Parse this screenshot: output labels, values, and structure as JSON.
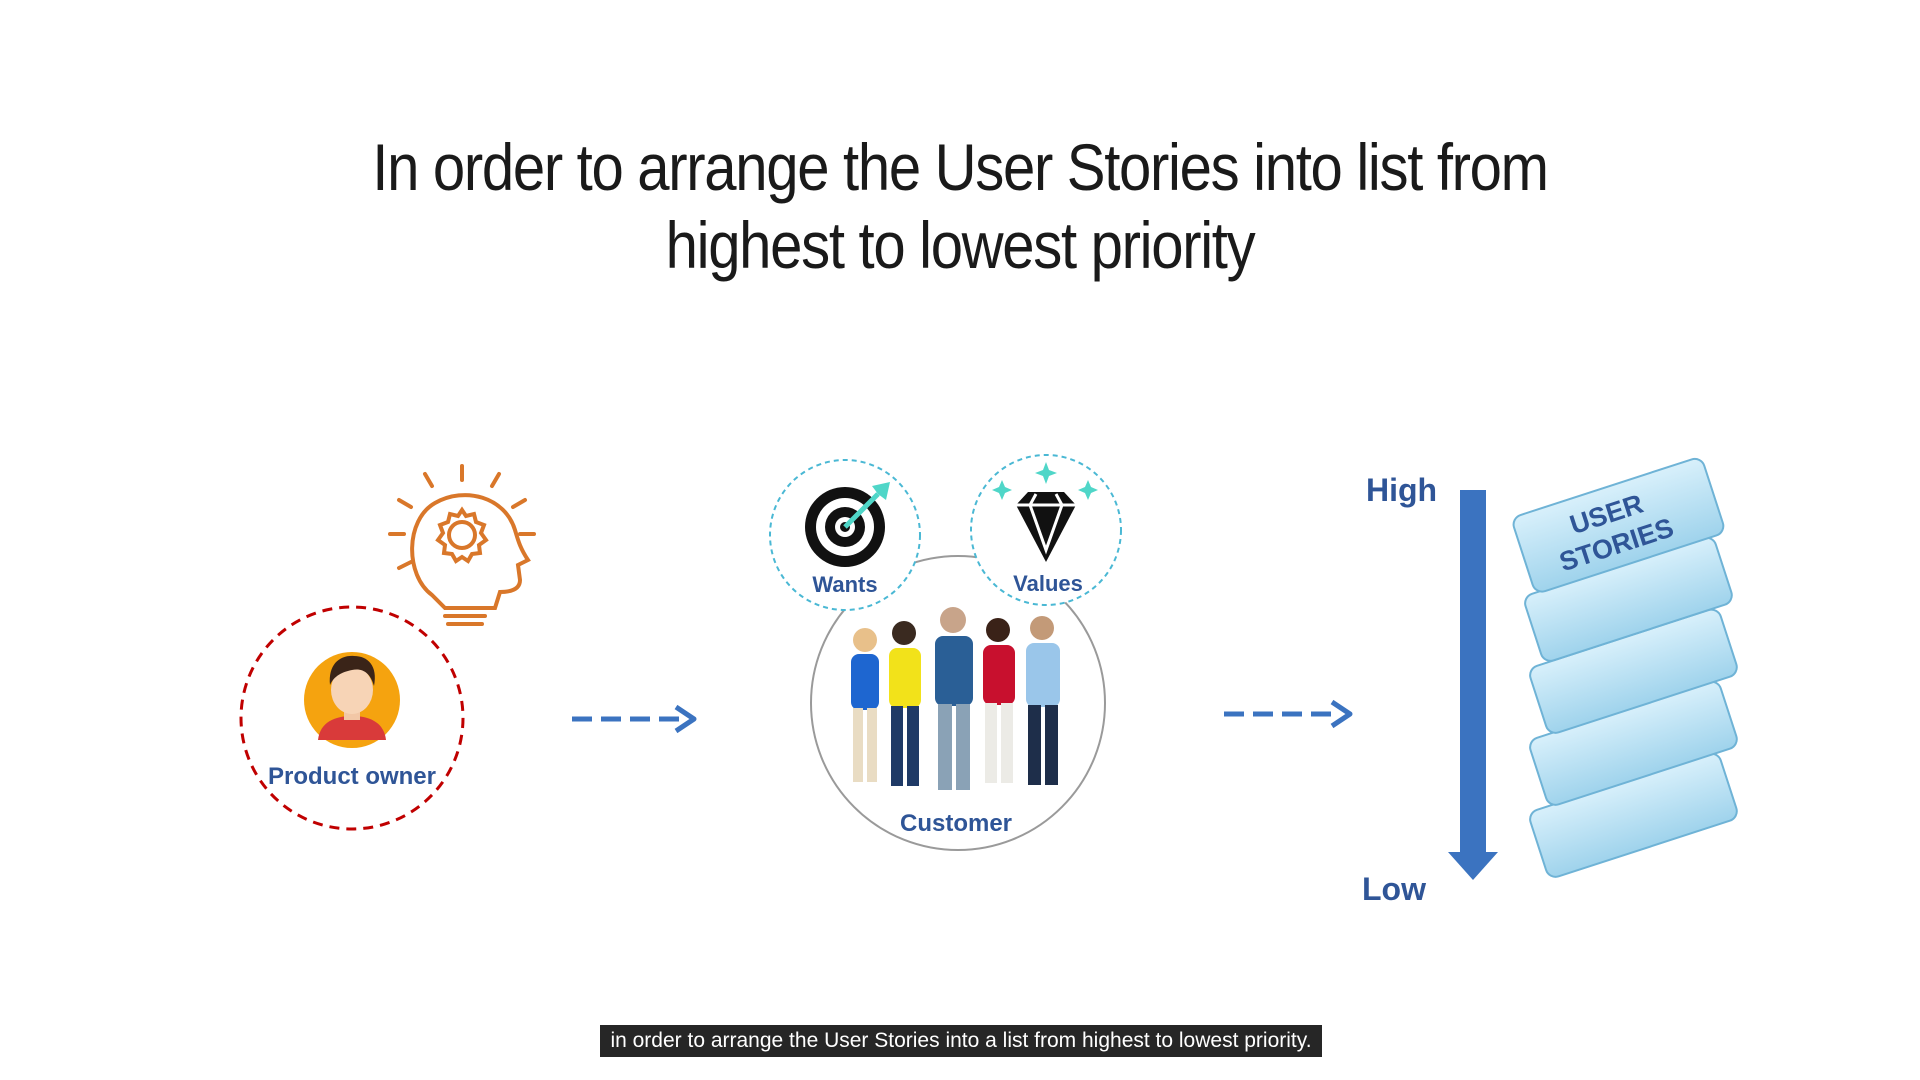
{
  "title": {
    "line1": "In order to arrange the User Stories into list from",
    "line2": "highest to lowest priority"
  },
  "labels": {
    "product_owner": "Product owner",
    "wants": "Wants",
    "values": "Values",
    "customer": "Customer",
    "high": "High",
    "low": "Low",
    "user": "USER",
    "stories": "STORIES"
  },
  "subtitle": "in order to arrange the User Stories into a list from highest to lowest priority.",
  "colors": {
    "label_blue": "#2f5597",
    "arrow_blue": "#3b73c0",
    "dashed_red": "#c00000",
    "idea_orange": "#d9772a",
    "card_fill": "#bfe3f4",
    "card_stroke": "#7fbcd9",
    "accent_teal": "#4fd6c8"
  }
}
